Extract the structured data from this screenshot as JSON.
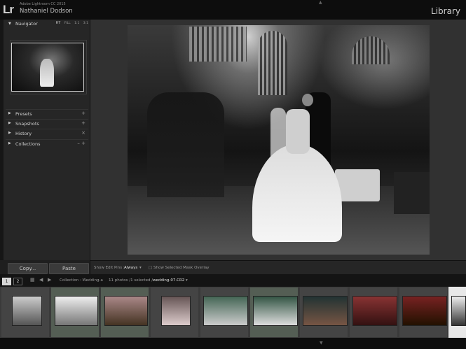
{
  "app": {
    "logo": "Lr",
    "product": "Adobe Lightroom CC 2015",
    "user": "Nathaniel Dodson",
    "module": "Library"
  },
  "navigator": {
    "title": "Navigator",
    "zoom_options": [
      "FIT",
      "FILL",
      "1:1",
      "3:1"
    ],
    "selected_zoom": "FIT"
  },
  "panels": [
    {
      "label": "Presets",
      "action": "+"
    },
    {
      "label": "Snapshots",
      "action": "+"
    },
    {
      "label": "History",
      "action": "×"
    },
    {
      "label": "Collections",
      "action": "– +"
    }
  ],
  "buttons": {
    "copy": "Copy...",
    "paste": "Paste"
  },
  "toolbar": {
    "edit_pins_label": "Show Edit Pins :",
    "edit_pins_value": "Always",
    "mask_overlay_label": "Show Selected Mask Overlay"
  },
  "filmstrip_bar": {
    "pages": [
      "1",
      "2"
    ],
    "collection": "Collection : Wedding-a",
    "count": "11 photos /1 selected /",
    "filename": "wedding-07.CR2"
  },
  "icons": {
    "grid": "grid-icon",
    "back": "arrow-left-icon",
    "forward": "arrow-right-icon",
    "expand": "disclosure-triangle-icon"
  },
  "colors": {
    "panel_bg": "#262626",
    "topbar_bg": "#0d0d0d",
    "filmstrip_bg": "#3a3a3a",
    "selected_cell": "#545e54"
  }
}
